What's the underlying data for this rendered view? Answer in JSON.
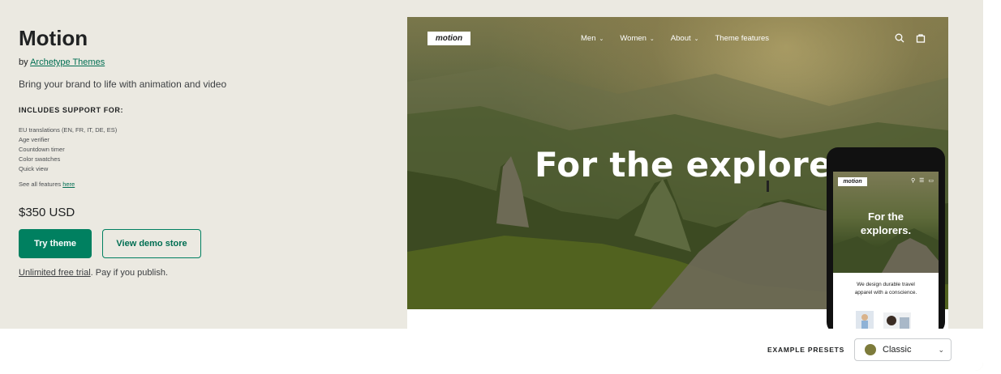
{
  "theme": {
    "title": "Motion",
    "by_prefix": "by",
    "author": "Archetype Themes",
    "tagline": "Bring your brand to life with animation and video",
    "support_title": "INCLUDES SUPPORT FOR:",
    "features": [
      "EU translations (EN, FR, IT, DE, ES)",
      "Age verifier",
      "Countdown timer",
      "Color swatches",
      "Quick view"
    ],
    "see_all_text": "See all features",
    "see_all_link": "here",
    "price": "$350 USD",
    "try_button": "Try theme",
    "demo_button": "View demo store",
    "trial_link": "Unlimited free trial",
    "trial_rest": ". Pay if you publish."
  },
  "preview": {
    "logo": "motion",
    "nav": [
      {
        "label": "Men",
        "has_dropdown": true
      },
      {
        "label": "Women",
        "has_dropdown": true
      },
      {
        "label": "About",
        "has_dropdown": true
      },
      {
        "label": "Theme features",
        "has_dropdown": false
      }
    ],
    "hero_title": "For the explorers.",
    "icons": [
      "search-icon",
      "cart-icon"
    ]
  },
  "phone": {
    "logo": "motion",
    "hero_title_line1": "For the",
    "hero_title_line2": "explorers.",
    "tagline_line1": "We design durable travel",
    "tagline_line2": "apparel with a conscience."
  },
  "footer": {
    "presets_label": "EXAMPLE PRESETS",
    "preset_value": "Classic",
    "preset_color": "#7d7b3b"
  },
  "colors": {
    "accent": "#008060",
    "background": "#ebe9e1"
  }
}
